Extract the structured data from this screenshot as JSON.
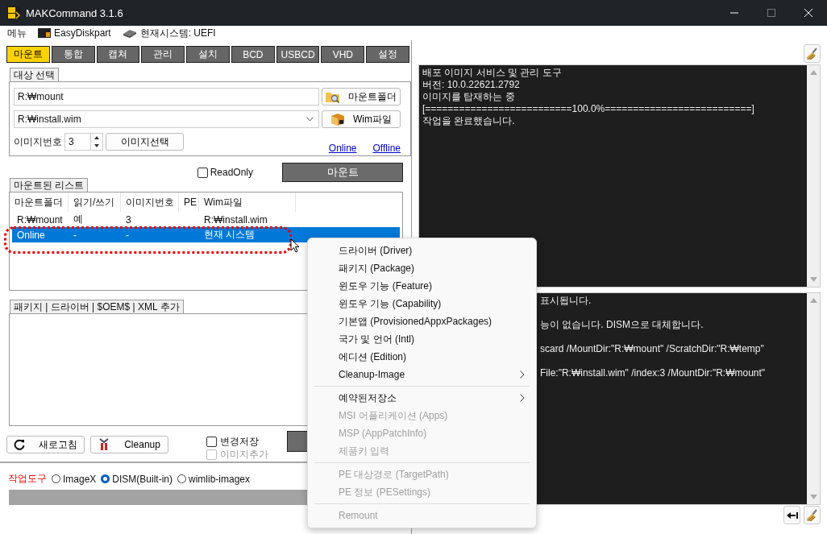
{
  "window": {
    "title": "MAKCommand 3.1.6"
  },
  "menu_bar": [
    {
      "label": "메뉴",
      "kind": "plain"
    },
    {
      "label": "EasyDiskpart",
      "kind": "terminal"
    },
    {
      "label": "현재시스템: UEFI",
      "kind": "chip"
    }
  ],
  "tabs": [
    {
      "label": "마운트",
      "selected": true
    },
    {
      "label": "통합",
      "selected": false
    },
    {
      "label": "캡쳐",
      "selected": false
    },
    {
      "label": "관리",
      "selected": false
    },
    {
      "label": "설치",
      "selected": false
    },
    {
      "label": "BCD",
      "selected": false
    },
    {
      "label": "USBCD",
      "selected": false
    },
    {
      "label": "VHD",
      "selected": false
    },
    {
      "label": "설정",
      "selected": false
    }
  ],
  "target": {
    "title": "대상 선택",
    "mount_folder": "R:₩mount",
    "mount_folder_button": "마운트폴더",
    "wim_file": "R:₩install.wim",
    "wim_button": "Wim파일",
    "image_number_label": "이미지번호",
    "image_number": "3",
    "image_select_button": "이미지선택",
    "links": [
      "Online",
      "Offline"
    ]
  },
  "readonly": {
    "label": "ReadOnly",
    "checked": false
  },
  "mount_button": "마운트",
  "mounted_list": {
    "title": "마운트된 리스트",
    "columns": [
      "마운트폴더",
      "읽기/쓰기",
      "이미지번호",
      "PE",
      "Wim파일"
    ],
    "rows": [
      {
        "folder": "R:₩mount",
        "mode": "예",
        "index": "3",
        "wim": "R:₩install.wim",
        "selected": false
      },
      {
        "folder": "Online",
        "mode": "-",
        "index": "-",
        "wim": "현재 시스템",
        "selected": true
      }
    ]
  },
  "add_panel": {
    "title": "패키지 | 드라이버 | $OEM$ | XML 추가"
  },
  "refresh_button": "새로고침",
  "cleanup_button": "Cleanup",
  "options": [
    {
      "label": "변경저장",
      "checked": false,
      "disabled": false
    },
    {
      "label": "이미지추가",
      "checked": false,
      "disabled": true
    }
  ],
  "tool": {
    "label": "작업도구",
    "choices": [
      {
        "label": "ImageX",
        "selected": false
      },
      {
        "label": "DISM(Built-in)",
        "selected": true
      },
      {
        "label": "wimlib-imagex",
        "selected": false
      }
    ]
  },
  "log_top": {
    "lines": [
      "배포 이미지 서비스 및 관리 도구",
      "버전: 10.0.22621.2792",
      "이미지를 탑재하는 중",
      "[==========================100.0%==========================]",
      "작업을 완료했습니다."
    ]
  },
  "log_bottom": {
    "lines": [
      "표시됩니다.",
      "능이 없습니다. DISM으로 대체합니다.",
      "scard /MountDir:\"R:₩mount\" /ScratchDir:\"R:₩temp\"",
      "File:\"R:₩install.wim\" /index:3 /MountDir:\"R:₩mount\""
    ]
  },
  "context_menu": [
    {
      "label": "드라이버 (Driver)",
      "disabled": false,
      "submenu": false,
      "separator_before": false
    },
    {
      "label": "패키지 (Package)",
      "disabled": false,
      "submenu": false,
      "separator_before": false
    },
    {
      "label": "윈도우 기능 (Feature)",
      "disabled": false,
      "submenu": false,
      "separator_before": false
    },
    {
      "label": "윈도우 기능 (Capability)",
      "disabled": false,
      "submenu": false,
      "separator_before": false
    },
    {
      "label": "기본앱 (ProvisionedAppxPackages)",
      "disabled": false,
      "submenu": false,
      "separator_before": false
    },
    {
      "label": "국가 및 언어 (Intl)",
      "disabled": false,
      "submenu": false,
      "separator_before": false
    },
    {
      "label": "에디션 (Edition)",
      "disabled": false,
      "submenu": false,
      "separator_before": false
    },
    {
      "label": "Cleanup-Image",
      "disabled": false,
      "submenu": true,
      "separator_before": false
    },
    {
      "label": "예약된저장소",
      "disabled": false,
      "submenu": true,
      "separator_before": true
    },
    {
      "label": "MSI 어플리케이션 (Apps)",
      "disabled": true,
      "submenu": false,
      "separator_before": false
    },
    {
      "label": "MSP (AppPatchInfo)",
      "disabled": true,
      "submenu": false,
      "separator_before": false
    },
    {
      "label": "제품키 입력",
      "disabled": true,
      "submenu": false,
      "separator_before": false
    },
    {
      "label": "PE 대상경로 (TargetPath)",
      "disabled": true,
      "submenu": false,
      "separator_before": true
    },
    {
      "label": "PE 정보 (PESettings)",
      "disabled": true,
      "submenu": false,
      "separator_before": false
    },
    {
      "label": "Remount",
      "disabled": true,
      "submenu": false,
      "separator_before": true
    }
  ]
}
